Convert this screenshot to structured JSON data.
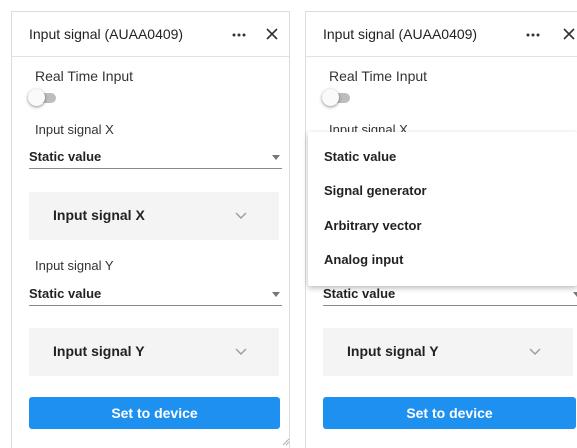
{
  "panels": {
    "left": {
      "title": "Input signal (AUAA0409)",
      "real_time_label": "Real Time Input",
      "real_time_enabled": false,
      "signal_x": {
        "label": "Input signal X",
        "selected": "Static value",
        "expander_label": "Input signal X"
      },
      "signal_y": {
        "label": "Input signal Y",
        "selected": "Static value",
        "expander_label": "Input signal Y"
      },
      "set_button_label": "Set to device"
    },
    "right": {
      "title": "Input signal (AUAA0409)",
      "real_time_label": "Real Time Input",
      "real_time_enabled": false,
      "signal_x": {
        "label": "Input signal X"
      },
      "signal_y": {
        "selected": "Static value",
        "expander_label": "Input signal Y"
      },
      "set_button_label": "Set to device",
      "dropdown_options": [
        "Static value",
        "Signal generator",
        "Arbitrary vector",
        "Analog input"
      ]
    }
  },
  "icons": {
    "more": "more-horizontal-icon",
    "close": "close-icon",
    "caret": "caret-down-icon",
    "chevron": "chevron-down-icon",
    "grip": "resize-grip-icon"
  },
  "colors": {
    "accent": "#1e90f0",
    "panel_border": "#dcdcdc",
    "expander_bg": "#f4f4f4",
    "toggle_off_track": "#bdbdbd"
  }
}
